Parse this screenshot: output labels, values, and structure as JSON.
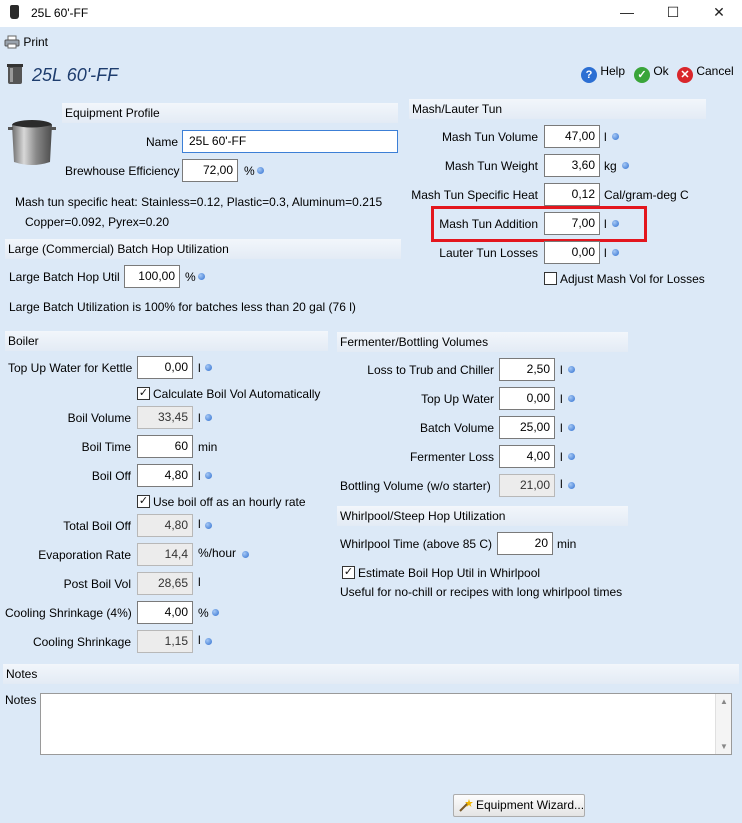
{
  "window": {
    "title": "25L 60'-FF",
    "minimize_glyph": "—",
    "maximize_glyph": "☐",
    "close_glyph": "✕"
  },
  "toolbar": {
    "print_label": "Print",
    "print_icon": "printer-icon"
  },
  "header": {
    "title": "25L 60'-FF",
    "help_label": "Help",
    "ok_label": "Ok",
    "cancel_label": "Cancel",
    "help_icon": "help-icon",
    "ok_icon": "checkmark-icon",
    "cancel_icon": "cancel-icon"
  },
  "equipment_profile": {
    "section_title": "Equipment Profile",
    "name_label": "Name",
    "name_value": "25L 60'-FF",
    "brewhouse_efficiency_label": "Brewhouse Efficiency",
    "brewhouse_efficiency_value": "72,00",
    "brewhouse_efficiency_unit": "%",
    "specific_heat_line1": "Mash tun specific heat: Stainless=0.12, Plastic=0.3, Aluminum=0.215",
    "specific_heat_line2": "Copper=0.092, Pyrex=0.20"
  },
  "hop_utilization": {
    "section_title": "Large (Commercial) Batch Hop Utilization",
    "large_batch_label": "Large Batch Hop Util",
    "large_batch_value": "100,00",
    "large_batch_unit": "%",
    "note": "Large Batch Utilization is 100% for batches less than 20 gal (76 l)"
  },
  "mash_lauter": {
    "section_title": "Mash/Lauter Tun",
    "volume_label": "Mash Tun Volume",
    "volume_value": "47,00",
    "volume_unit": "l",
    "weight_label": "Mash Tun Weight",
    "weight_value": "3,60",
    "weight_unit": "kg",
    "specific_heat_label": "Mash Tun Specific Heat",
    "specific_heat_value": "0,12",
    "specific_heat_unit": "Cal/gram-deg C",
    "addition_label": "Mash Tun Addition",
    "addition_value": "7,00",
    "addition_unit": "l",
    "lauter_losses_label": "Lauter Tun Losses",
    "lauter_losses_value": "0,00",
    "lauter_losses_unit": "l",
    "adjust_label": "Adjust Mash Vol for Losses",
    "adjust_checked": false
  },
  "boiler": {
    "section_title": "Boiler",
    "top_up_label": "Top Up Water for Kettle",
    "top_up_value": "0,00",
    "top_up_unit": "l",
    "calc_auto_label": "Calculate Boil Vol Automatically",
    "calc_auto_checked": true,
    "boil_volume_label": "Boil Volume",
    "boil_volume_value": "33,45",
    "boil_volume_unit": "l",
    "boil_time_label": "Boil Time",
    "boil_time_value": "60",
    "boil_time_unit": "min",
    "boil_off_label": "Boil Off",
    "boil_off_value": "4,80",
    "boil_off_unit": "l",
    "hourly_label": "Use boil off as an hourly rate",
    "hourly_checked": true,
    "total_boil_off_label": "Total Boil Off",
    "total_boil_off_value": "4,80",
    "total_boil_off_unit": "l",
    "evap_rate_label": "Evaporation Rate",
    "evap_rate_value": "14,4",
    "evap_rate_unit": "%/hour",
    "post_boil_label": "Post Boil Vol",
    "post_boil_value": "28,65",
    "post_boil_unit": "l",
    "cooling_pct_label": "Cooling Shrinkage (4%)",
    "cooling_pct_value": "4,00",
    "cooling_pct_unit": "%",
    "cooling_label": "Cooling Shrinkage",
    "cooling_value": "1,15",
    "cooling_unit": "l"
  },
  "fermenter": {
    "section_title": "Fermenter/Bottling Volumes",
    "trub_label": "Loss to Trub and Chiller",
    "trub_value": "2,50",
    "trub_unit": "l",
    "topup_label": "Top Up Water",
    "topup_value": "0,00",
    "topup_unit": "l",
    "batch_label": "Batch Volume",
    "batch_value": "25,00",
    "batch_unit": "l",
    "fermenter_loss_label": "Fermenter Loss",
    "fermenter_loss_value": "4,00",
    "fermenter_loss_unit": "l",
    "bottling_label": "Bottling Volume (w/o starter)",
    "bottling_value": "21,00",
    "bottling_unit": "l"
  },
  "whirlpool": {
    "section_title": "Whirlpool/Steep Hop Utilization",
    "time_label": "Whirlpool Time (above 85 C)",
    "time_value": "20",
    "time_unit": "min",
    "estimate_label": "Estimate Boil Hop Util in Whirlpool",
    "estimate_checked": true,
    "note": "Useful for no-chill or recipes with long whirlpool times"
  },
  "notes": {
    "section_title": "Notes",
    "label": "Notes",
    "value": ""
  },
  "footer": {
    "wizard_label": "Equipment Wizard...",
    "wizard_icon": "wand-icon"
  },
  "colors": {
    "background": "#dce9f7",
    "highlight": "#e3161e",
    "info_dot": "#2f6fd0"
  }
}
